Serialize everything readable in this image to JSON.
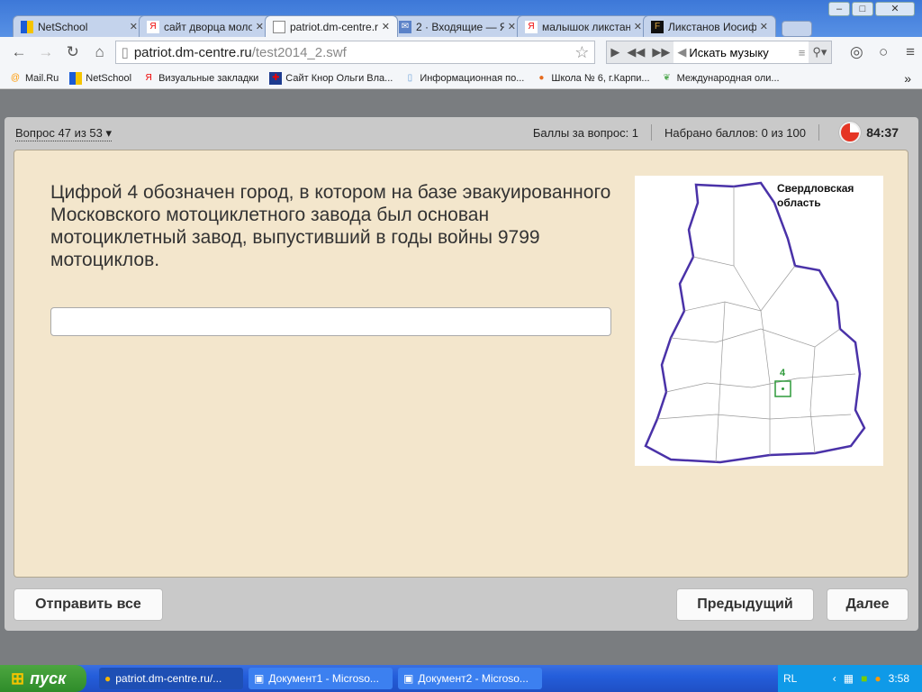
{
  "browser": {
    "tabs": [
      {
        "title": "NetSchool",
        "icon": "netschool-icon"
      },
      {
        "title": "сайт дворца моло",
        "icon": "yandex-icon"
      },
      {
        "title": "patriot.dm-centre.r",
        "icon": "page-icon",
        "active": true
      },
      {
        "title": "2 · Входящие — Я",
        "icon": "mail-icon"
      },
      {
        "title": "малышок ликстан",
        "icon": "yandex-icon"
      },
      {
        "title": "Ликстанов Иосиф",
        "icon": "fr-icon"
      }
    ],
    "url_host": "patriot.dm-centre.ru",
    "url_path": "/test2014_2.swf",
    "music_search_placeholder": "Искать музыку",
    "bookmarks": [
      "Mail.Ru",
      "NetSchool",
      "Визуальные закладки",
      "Сайт Кнор Ольги Вла...",
      "Информационная по...",
      "Школа № 6, г.Карпи...",
      "Международная оли..."
    ],
    "more": "»"
  },
  "quiz": {
    "question_nav": "Вопрос 47 из 53",
    "points_per_question": "Баллы за вопрос: 1",
    "total_points": "Набрано баллов: 0 из 100",
    "timer": "84:37",
    "question": "Цифрой 4 обозначен город, в котором на базе эвакуированного Московского мотоциклетного завода был основан мотоциклетный завод, выпустивший в годы войны 9799 мотоциклов.",
    "answer_value": "",
    "map_label_line1": "Свердловская",
    "map_label_line2": "область",
    "map_marker": "4",
    "submit_all": "Отправить все",
    "previous": "Предыдущий",
    "next": "Далее"
  },
  "taskbar": {
    "start": "пуск",
    "tasks": [
      "patriot.dm-centre.ru/...",
      "Документ1 - Microso...",
      "Документ2 - Microso..."
    ],
    "lang": "RL",
    "clock": "3:58"
  }
}
